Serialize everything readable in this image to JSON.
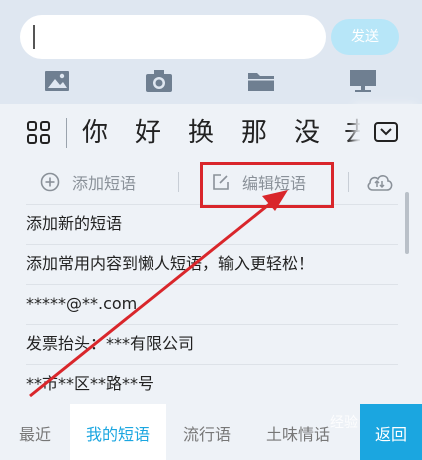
{
  "input": {
    "send_label": "发送"
  },
  "tools": [
    {
      "icon": "image-icon"
    },
    {
      "icon": "camera-icon"
    },
    {
      "icon": "folder-icon"
    },
    {
      "icon": "desktop-icon"
    }
  ],
  "candidates": [
    "你",
    "好",
    "换",
    "那",
    "没",
    "去"
  ],
  "actions": {
    "add_phrase": "添加短语",
    "edit_phrase": "编辑短语"
  },
  "phrases": [
    "添加新的短语",
    "添加常用内容到懒人短语，输入更轻松！",
    "*****@**.com",
    "发票抬头：***有限公司",
    "**市**区**路**号"
  ],
  "tabs": [
    "最近",
    "我的短语",
    "流行语",
    "土味情话"
  ],
  "active_tab": "我的短语",
  "back_label": "返回",
  "watermark": "经验",
  "colors": {
    "accent": "#1ba6e0",
    "annotation": "#d9262b"
  }
}
